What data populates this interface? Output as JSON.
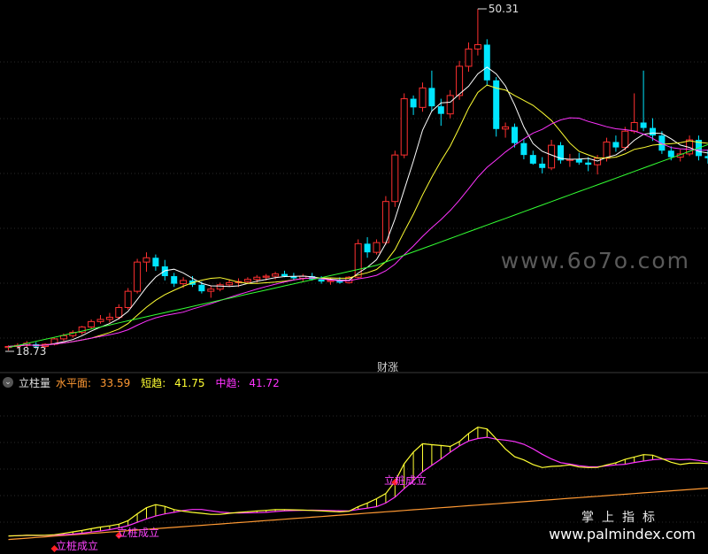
{
  "price_chart": {
    "max_label": "50.31",
    "min_label": "18.73",
    "event_tag": "财涨",
    "watermark": "www.6o7o.com",
    "colors": {
      "up": "#ff3030",
      "down": "#00e5ff",
      "ma5": "#ffffff",
      "ma10": "#ffff33",
      "ma20": "#ff33ff",
      "ma60": "#33ff33"
    }
  },
  "indicator": {
    "name": "立柱量",
    "horizontal_label": "水平面:",
    "horizontal_value": "33.59",
    "short_label": "短趋:",
    "short_value": "41.75",
    "mid_label": "中趋:",
    "mid_value": "41.72",
    "colors": {
      "horizontal": "#ff9933",
      "short": "#ffff33",
      "mid": "#ff33ff"
    }
  },
  "signals": [
    "立桩成立",
    "立桩成立",
    "立桩成立"
  ],
  "brand": {
    "cn": "掌上指标",
    "url": "www.palmindex.com"
  },
  "chart_data": {
    "type": "candlestick",
    "title": "",
    "price_range": [
      18.73,
      50.31
    ],
    "candles": [
      [
        19.0,
        19.2,
        18.73,
        19.1
      ],
      [
        19.1,
        19.4,
        18.9,
        19.2
      ],
      [
        19.2,
        19.6,
        19.0,
        19.4
      ],
      [
        19.3,
        19.5,
        18.9,
        19.1
      ],
      [
        19.1,
        19.4,
        18.9,
        19.3
      ],
      [
        19.3,
        19.9,
        19.2,
        19.8
      ],
      [
        19.8,
        20.3,
        19.6,
        20.1
      ],
      [
        20.1,
        20.6,
        19.9,
        20.4
      ],
      [
        20.4,
        21.0,
        20.2,
        20.9
      ],
      [
        20.9,
        21.6,
        20.7,
        21.4
      ],
      [
        21.4,
        22.0,
        21.2,
        21.6
      ],
      [
        21.6,
        22.2,
        21.3,
        21.8
      ],
      [
        21.8,
        23.0,
        21.6,
        22.7
      ],
      [
        22.7,
        24.5,
        22.5,
        24.2
      ],
      [
        24.2,
        27.2,
        24.0,
        26.9
      ],
      [
        26.9,
        27.8,
        26.0,
        27.3
      ],
      [
        27.3,
        27.6,
        26.1,
        26.5
      ],
      [
        26.5,
        27.1,
        25.2,
        25.6
      ],
      [
        25.6,
        25.9,
        24.6,
        24.9
      ],
      [
        24.9,
        25.5,
        24.5,
        25.2
      ],
      [
        25.2,
        25.6,
        24.6,
        24.8
      ],
      [
        24.8,
        25.1,
        24.0,
        24.2
      ],
      [
        24.2,
        24.7,
        23.6,
        24.4
      ],
      [
        24.4,
        25.0,
        24.2,
        24.8
      ],
      [
        24.8,
        25.3,
        24.6,
        25.0
      ],
      [
        25.0,
        25.4,
        24.6,
        25.1
      ],
      [
        25.1,
        25.5,
        24.9,
        25.3
      ],
      [
        25.3,
        25.7,
        25.0,
        25.5
      ],
      [
        25.5,
        25.8,
        25.2,
        25.6
      ],
      [
        25.6,
        26.0,
        25.3,
        25.8
      ],
      [
        25.8,
        26.1,
        25.5,
        25.6
      ],
      [
        25.6,
        25.9,
        25.2,
        25.4
      ],
      [
        25.4,
        25.8,
        25.1,
        25.6
      ],
      [
        25.6,
        25.9,
        25.2,
        25.3
      ],
      [
        25.3,
        25.6,
        24.9,
        25.1
      ],
      [
        25.1,
        25.4,
        24.8,
        25.2
      ],
      [
        25.2,
        25.5,
        24.9,
        25.0
      ],
      [
        25.0,
        25.6,
        24.9,
        25.5
      ],
      [
        25.5,
        29.0,
        25.4,
        28.6
      ],
      [
        28.6,
        29.2,
        27.3,
        27.8
      ],
      [
        27.8,
        29.0,
        27.6,
        28.7
      ],
      [
        28.7,
        33.0,
        28.5,
        32.5
      ],
      [
        32.5,
        37.2,
        32.0,
        36.8
      ],
      [
        36.8,
        42.5,
        36.5,
        42.0
      ],
      [
        42.0,
        42.3,
        40.5,
        41.2
      ],
      [
        41.2,
        43.5,
        40.8,
        43.0
      ],
      [
        43.0,
        44.6,
        40.8,
        41.3
      ],
      [
        41.3,
        42.0,
        39.5,
        40.6
      ],
      [
        40.6,
        42.8,
        40.2,
        42.3
      ],
      [
        42.3,
        45.5,
        41.9,
        45.0
      ],
      [
        45.0,
        47.2,
        44.5,
        46.6
      ],
      [
        46.6,
        50.31,
        46.0,
        47.0
      ],
      [
        47.0,
        47.5,
        43.2,
        43.7
      ],
      [
        43.7,
        44.0,
        38.5,
        39.2
      ],
      [
        39.2,
        39.8,
        38.4,
        39.4
      ],
      [
        39.4,
        39.7,
        37.5,
        37.9
      ],
      [
        37.9,
        38.3,
        36.4,
        36.8
      ],
      [
        36.8,
        37.2,
        35.9,
        36.0
      ],
      [
        36.0,
        36.6,
        35.1,
        35.6
      ],
      [
        35.6,
        38.2,
        35.4,
        37.7
      ],
      [
        37.7,
        38.0,
        36.0,
        36.3
      ],
      [
        36.3,
        36.9,
        35.7,
        36.4
      ],
      [
        36.4,
        37.0,
        35.9,
        36.1
      ],
      [
        36.1,
        36.6,
        35.3,
        35.9
      ],
      [
        35.9,
        36.8,
        35.0,
        36.5
      ],
      [
        36.5,
        38.4,
        36.2,
        38.0
      ],
      [
        38.0,
        38.6,
        37.1,
        37.5
      ],
      [
        37.5,
        39.4,
        37.2,
        39.0
      ],
      [
        39.0,
        42.5,
        38.8,
        39.8
      ],
      [
        39.8,
        44.6,
        39.0,
        39.3
      ],
      [
        39.3,
        40.2,
        38.1,
        38.6
      ],
      [
        38.6,
        39.0,
        36.9,
        37.2
      ],
      [
        37.2,
        37.6,
        36.3,
        36.6
      ],
      [
        36.6,
        37.3,
        36.2,
        36.9
      ],
      [
        36.9,
        38.6,
        36.7,
        38.2
      ],
      [
        38.2,
        38.6,
        36.3,
        36.7
      ],
      [
        36.7,
        37.3,
        36.0,
        36.5
      ]
    ]
  }
}
